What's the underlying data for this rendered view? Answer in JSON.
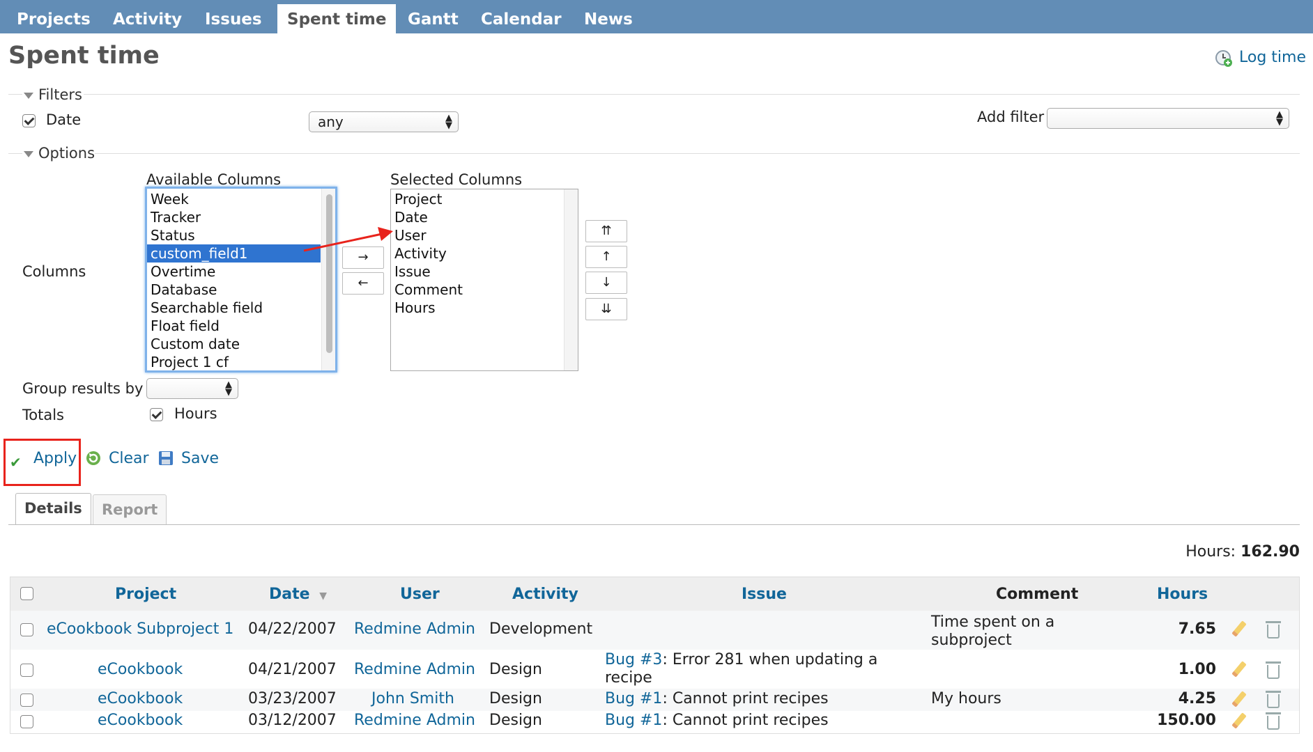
{
  "nav": {
    "tabs": [
      "Projects",
      "Activity",
      "Issues",
      "Spent time",
      "Gantt",
      "Calendar",
      "News"
    ],
    "active_tab": "Spent time"
  },
  "page": {
    "title": "Spent time",
    "log_time_label": "Log time"
  },
  "filters": {
    "legend": "Filters",
    "date_label": "Date",
    "date_checked": true,
    "date_operator": "any",
    "add_filter_label": "Add filter",
    "add_filter_value": ""
  },
  "options": {
    "legend": "Options",
    "columns_label": "Columns",
    "available_columns_label": "Available Columns",
    "available_columns": [
      "Week",
      "Tracker",
      "Status",
      "custom_field1",
      "Overtime",
      "Database",
      "Searchable field",
      "Float field",
      "Custom date",
      "Project 1 cf"
    ],
    "available_selected": "custom_field1",
    "selected_columns_label": "Selected Columns",
    "selected_columns": [
      "Project",
      "Date",
      "User",
      "Activity",
      "Issue",
      "Comment",
      "Hours"
    ],
    "move_right": "→",
    "move_left": "←",
    "move_top": "⇈",
    "move_up": "↑",
    "move_down": "↓",
    "move_bottom": "⇊",
    "group_by_label": "Group results by",
    "group_by_value": "",
    "totals_label": "Totals",
    "totals_hours_label": "Hours",
    "totals_hours_checked": true
  },
  "actions": {
    "apply": "Apply",
    "clear": "Clear",
    "save": "Save"
  },
  "content_tabs": {
    "details": "Details",
    "report": "Report",
    "active": "Details"
  },
  "totals": {
    "label": "Hours:",
    "value": "162.90"
  },
  "table": {
    "headers": {
      "project": "Project",
      "date": "Date",
      "user": "User",
      "activity": "Activity",
      "issue": "Issue",
      "comment": "Comment",
      "hours": "Hours"
    },
    "rows": [
      {
        "project": "eCookbook Subproject 1",
        "date": "04/22/2007",
        "user": "Redmine Admin",
        "activity": "Development",
        "issue_link": "",
        "issue_text": "",
        "comment": "Time spent on a subproject",
        "hours": "7.65"
      },
      {
        "project": "eCookbook",
        "date": "04/21/2007",
        "user": "Redmine Admin",
        "activity": "Design",
        "issue_link": "Bug #3",
        "issue_text": ": Error 281 when updating a recipe",
        "comment": "",
        "hours": "1.00"
      },
      {
        "project": "eCookbook",
        "date": "03/23/2007",
        "user": "John Smith",
        "activity": "Design",
        "issue_link": "Bug #1",
        "issue_text": ": Cannot print recipes",
        "comment": "My hours",
        "hours": "4.25"
      },
      {
        "project": "eCookbook",
        "date": "03/12/2007",
        "user": "Redmine Admin",
        "activity": "Design",
        "issue_link": "Bug #1",
        "issue_text": ": Cannot print recipes",
        "comment": "",
        "hours": "150.00"
      }
    ]
  },
  "colors": {
    "topbar": "#628db6",
    "link": "#116699",
    "selection": "#2f74d0",
    "annotation_red": "#e8231c"
  }
}
